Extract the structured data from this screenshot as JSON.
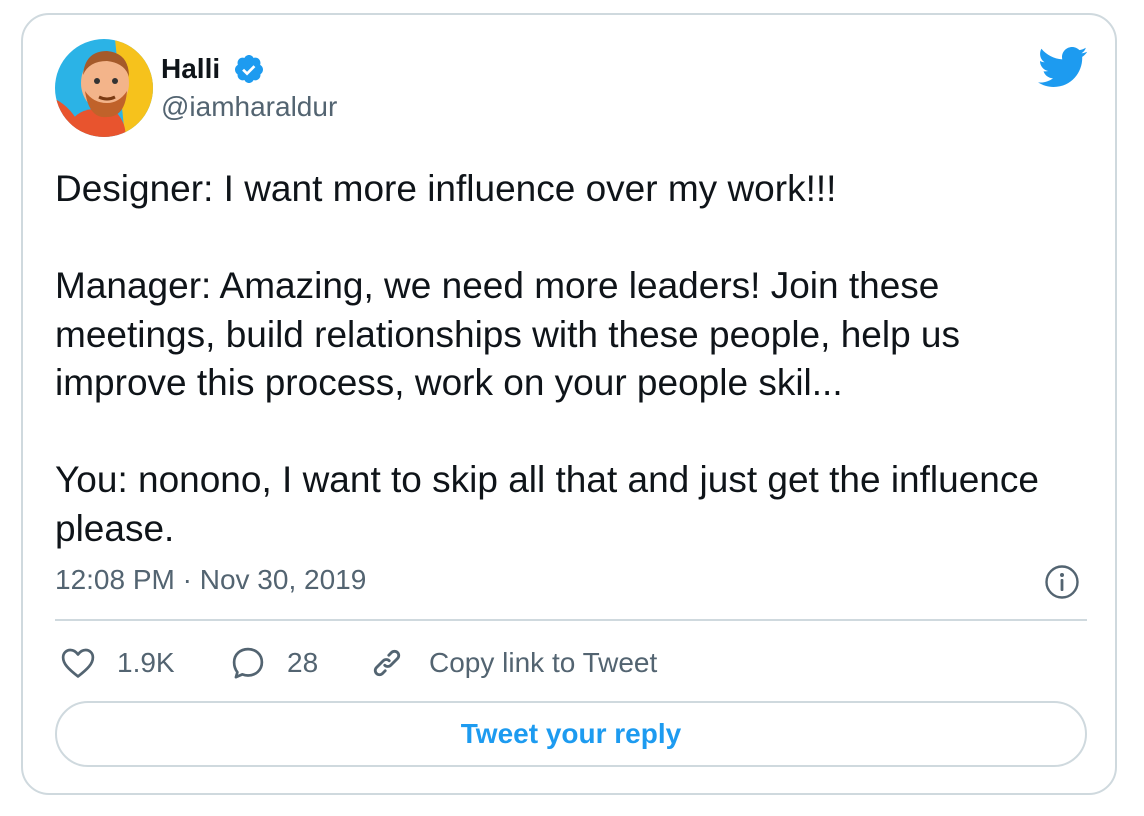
{
  "author": {
    "name": "Halli",
    "handle": "@iamharaldur",
    "verified": true
  },
  "tweet": {
    "paragraphs": [
      "Designer: I want more influence over my work!!!",
      "Manager: Amazing, we need more leaders! Join these meetings, build relationships with these people, help us improve this process, work on your people skil...",
      "You: nonono, I want to skip all that and just get the influence please."
    ],
    "timestamp": "12:08 PM · Nov 30, 2019"
  },
  "actions": {
    "likes": "1.9K",
    "replies": "28",
    "copy_link_label": "Copy link to Tweet"
  },
  "reply_button_label": "Tweet your reply",
  "icons": {
    "brand": "twitter-bird-icon",
    "verified": "verified-badge-icon",
    "info": "info-icon",
    "like": "heart-icon",
    "reply": "reply-bubble-icon",
    "copy": "link-icon"
  },
  "colors": {
    "accent": "#1d9bf0",
    "text": "#0f1419",
    "secondary_text": "#536471",
    "border": "#cfd9de"
  }
}
